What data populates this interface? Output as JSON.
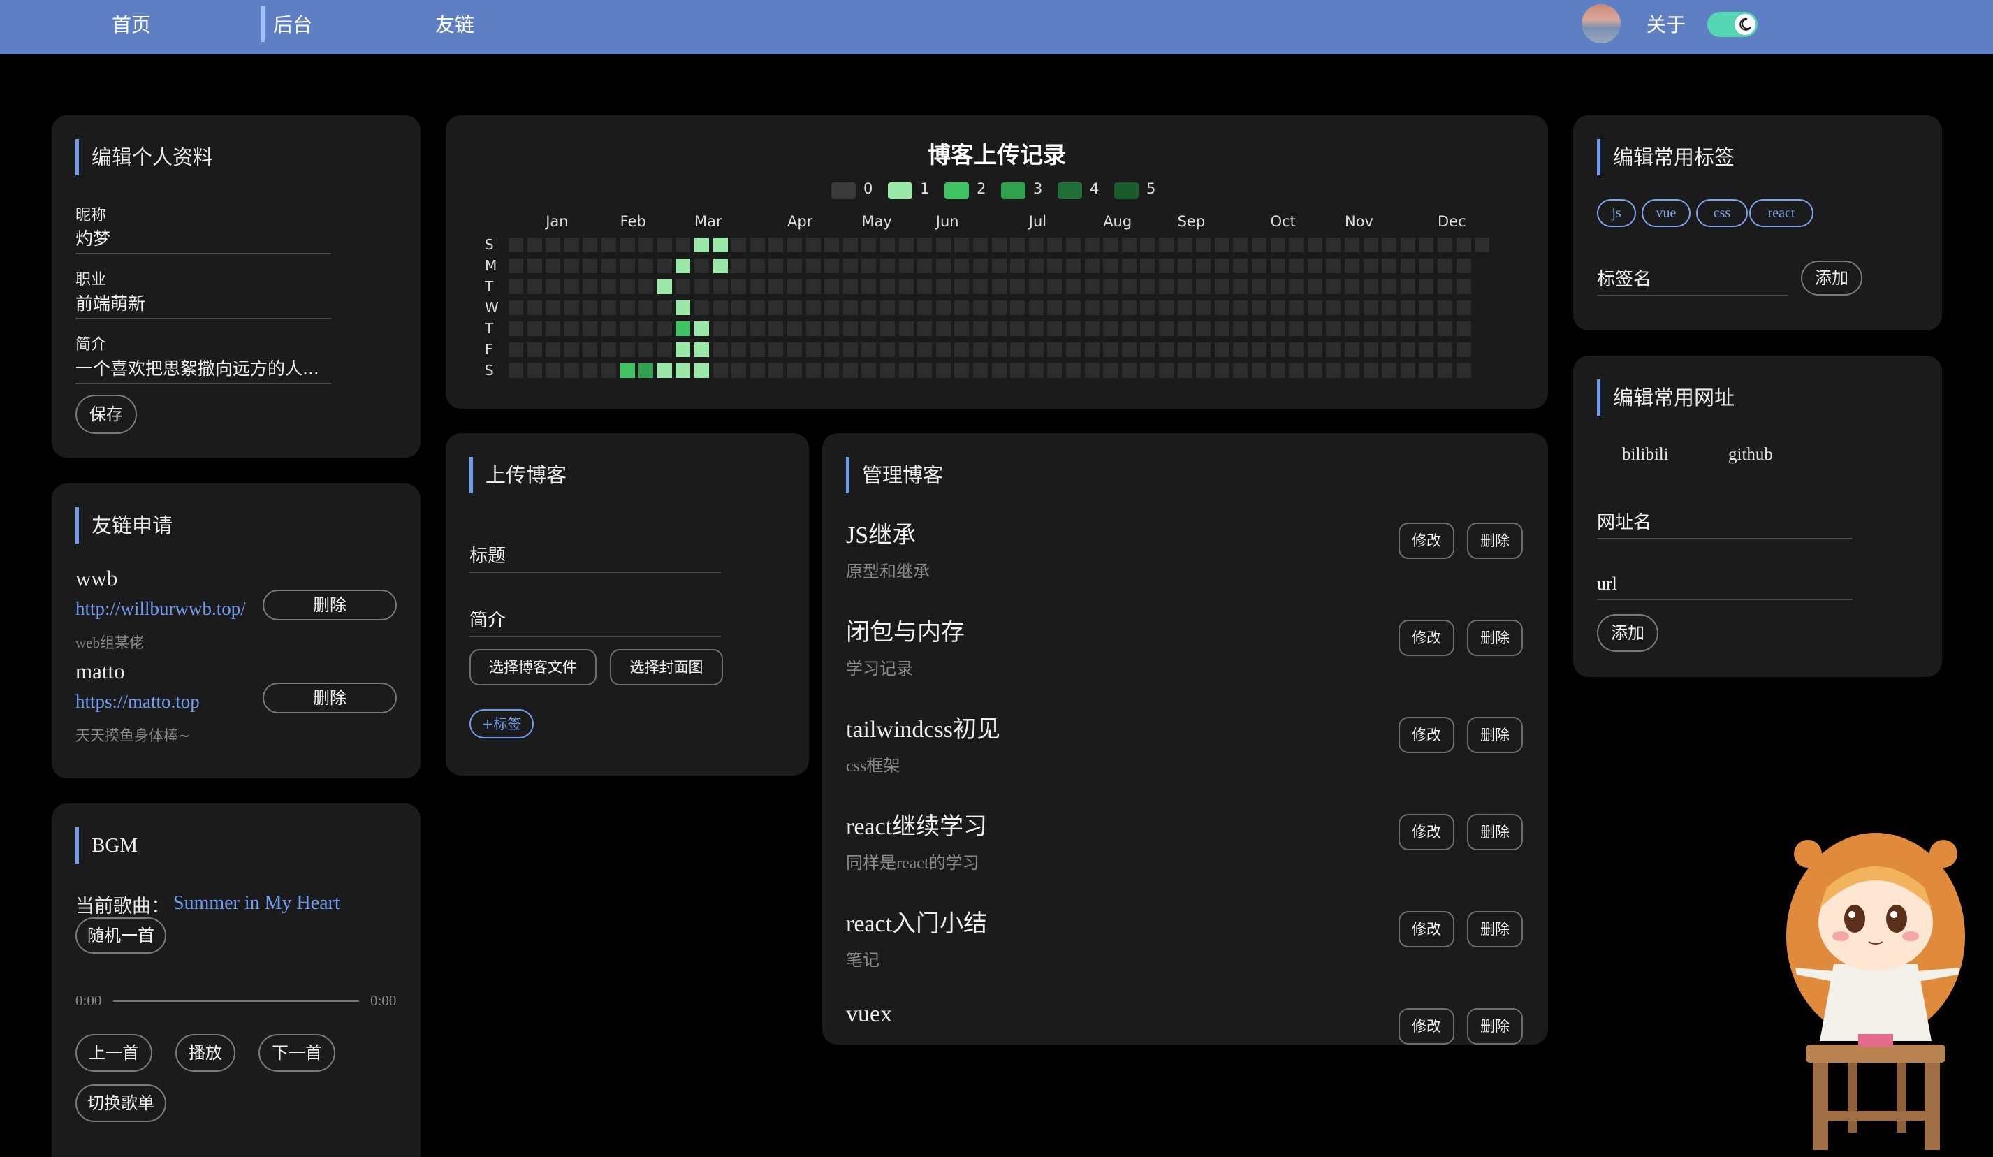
{
  "nav": {
    "home": "首页",
    "admin": "后台",
    "friends": "友链",
    "about": "关于"
  },
  "profile": {
    "title": "编辑个人资料",
    "nickname_label": "昵称",
    "nickname": "灼梦",
    "job_label": "职业",
    "job": "前端萌新",
    "intro_label": "简介",
    "intro": "一个喜欢把思絮撒向远方的人...",
    "save": "保存"
  },
  "friend_requests": {
    "title": "友链申请",
    "items": [
      {
        "name": "wwb",
        "url": "http://willburwwb.top/",
        "desc": "web组某佬",
        "delete": "删除"
      },
      {
        "name": "matto",
        "url": "https://matto.top",
        "desc": "天天摸鱼身体棒~",
        "delete": "删除"
      }
    ]
  },
  "bgm": {
    "title": "BGM",
    "current_label": "当前歌曲：",
    "current_song": "Summer in My Heart",
    "random": "随机一首",
    "time_start": "0:00",
    "time_end": "0:00",
    "progress": 0,
    "prev": "上一首",
    "play": "播放",
    "next": "下一首",
    "switch_list": "切换歌单"
  },
  "heatmap": {
    "title": "博客上传记录",
    "legend": [
      "0",
      "1",
      "2",
      "3",
      "4",
      "5"
    ],
    "legend_colors": [
      "#3a3a3a",
      "#9be9a8",
      "#40c463",
      "#30a14e",
      "#216e39",
      "#195c2c"
    ],
    "months": [
      "Jan",
      "Feb",
      "Mar",
      "Apr",
      "May",
      "Jun",
      "Jul",
      "Aug",
      "Sep",
      "Oct",
      "Nov",
      "Dec"
    ],
    "days": [
      "S",
      "M",
      "T",
      "W",
      "T",
      "F",
      "S"
    ],
    "active_cells": [
      {
        "week": 6,
        "day": 6,
        "level": 2
      },
      {
        "week": 7,
        "day": 6,
        "level": 3
      },
      {
        "week": 8,
        "day": 2,
        "level": 1
      },
      {
        "week": 8,
        "day": 6,
        "level": 1
      },
      {
        "week": 9,
        "day": 1,
        "level": 1
      },
      {
        "week": 9,
        "day": 3,
        "level": 1
      },
      {
        "week": 9,
        "day": 4,
        "level": 2
      },
      {
        "week": 9,
        "day": 5,
        "level": 1
      },
      {
        "week": 9,
        "day": 6,
        "level": 1
      },
      {
        "week": 10,
        "day": 0,
        "level": 1
      },
      {
        "week": 10,
        "day": 4,
        "level": 1
      },
      {
        "week": 10,
        "day": 5,
        "level": 1
      },
      {
        "week": 10,
        "day": 6,
        "level": 1
      },
      {
        "week": 11,
        "day": 0,
        "level": 1
      },
      {
        "week": 11,
        "day": 1,
        "level": 1
      }
    ]
  },
  "upload": {
    "title": "上传博客",
    "title_placeholder": "标题",
    "intro_placeholder": "简介",
    "choose_file": "选择博客文件",
    "choose_cover": "选择封面图",
    "add_tag": "+标签"
  },
  "manage": {
    "title": "管理博客",
    "edit": "修改",
    "delete": "删除",
    "posts": [
      {
        "title": "JS继承",
        "desc": "原型和继承"
      },
      {
        "title": "闭包与内存",
        "desc": "学习记录"
      },
      {
        "title": "tailwindcss初见",
        "desc": "css框架"
      },
      {
        "title": "react继续学习",
        "desc": "同样是react的学习"
      },
      {
        "title": "react入门小结",
        "desc": "笔记"
      },
      {
        "title": "vuex",
        "desc": ""
      }
    ]
  },
  "tags": {
    "title": "编辑常用标签",
    "items": [
      "js",
      "vue",
      "css",
      "react"
    ],
    "input_placeholder": "标签名",
    "add": "添加"
  },
  "urls": {
    "title": "编辑常用网址",
    "items": [
      "bilibili",
      "github"
    ],
    "name_placeholder": "网址名",
    "url_placeholder": "url",
    "add": "添加"
  },
  "colors": {
    "nav": "#5f7fc4",
    "accent": "#6f9bf0",
    "card": "#1b1b1b",
    "toggle": "#54d6b2"
  }
}
